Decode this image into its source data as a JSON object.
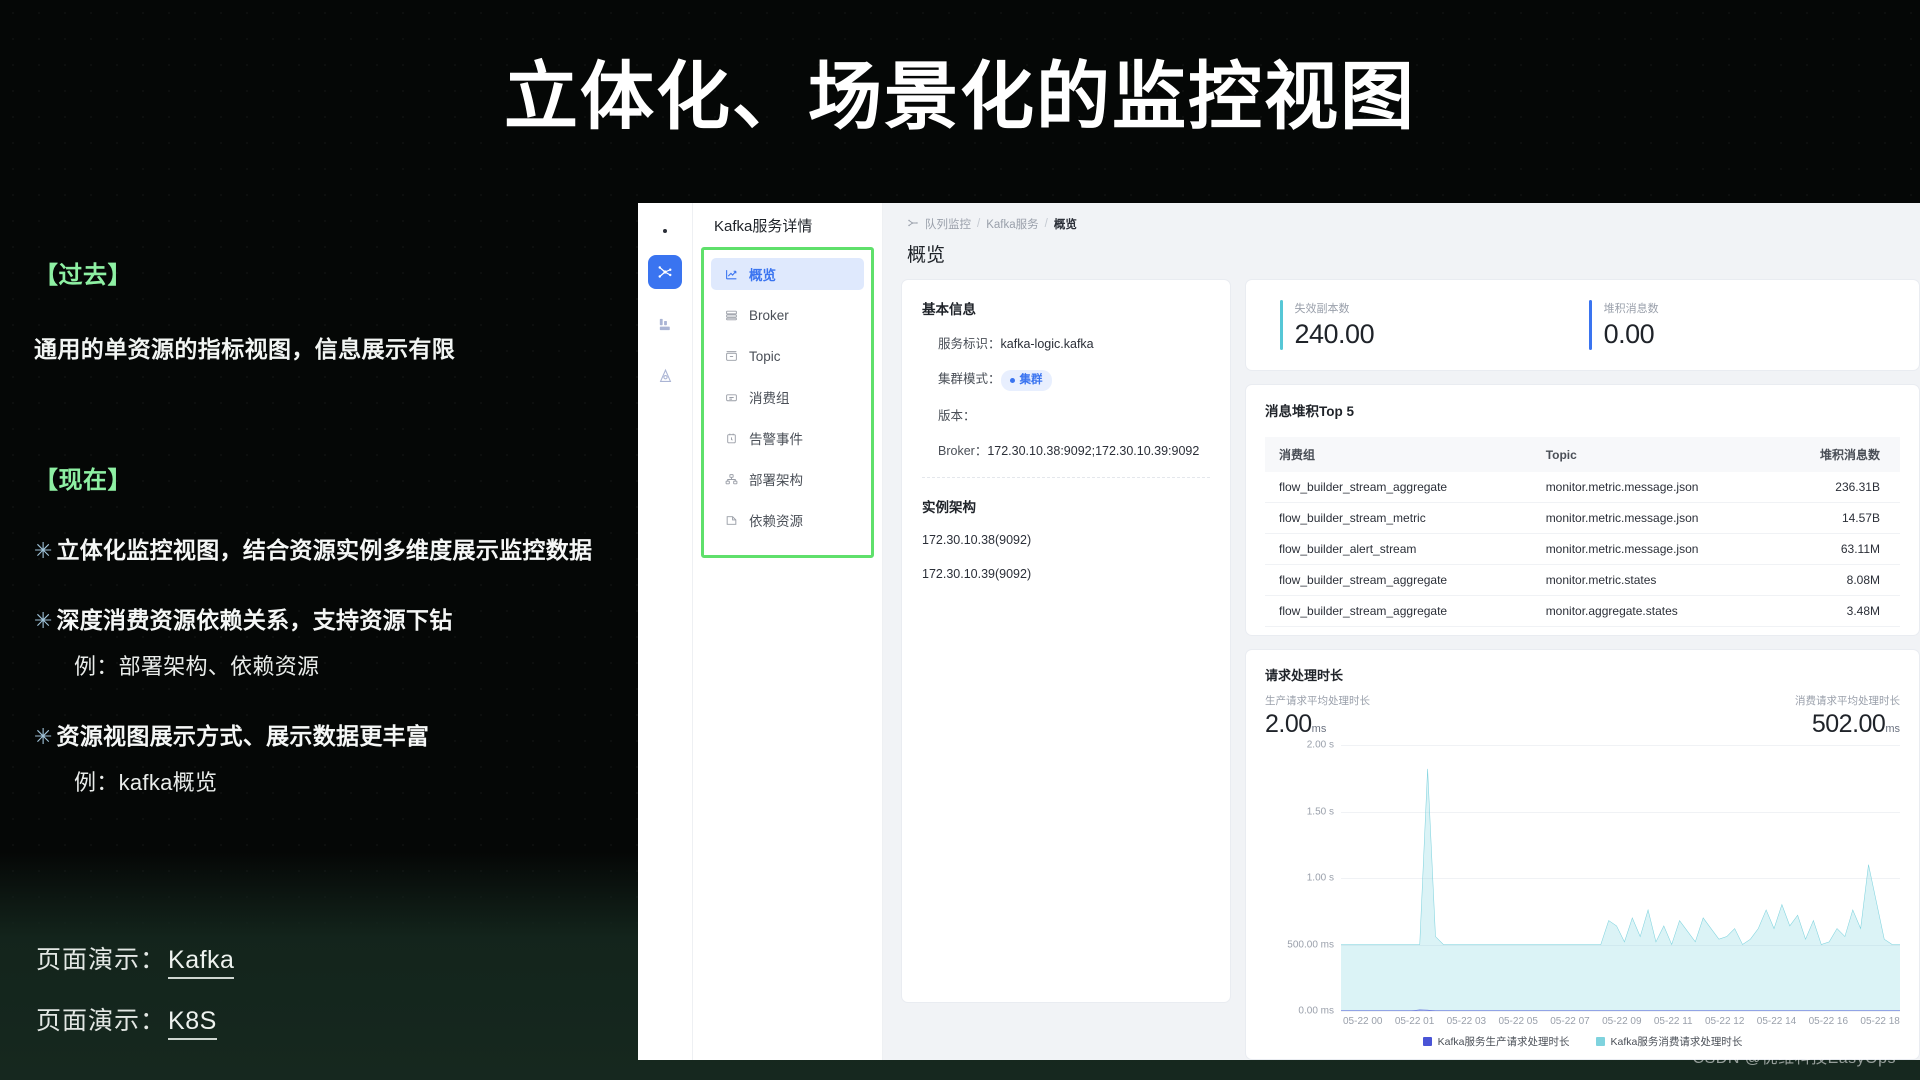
{
  "slide": {
    "title": "立体化、场景化的监控视图",
    "past": {
      "label": "【过去】",
      "body": "通用的单资源的指标视图，信息展示有限"
    },
    "now": {
      "label": "【现在】"
    },
    "bullets": [
      {
        "marker": "✳",
        "text": "立体化监控视图，结合资源实例多维度展示监控数据",
        "sub": ""
      },
      {
        "marker": "✳",
        "text": "深度消费资源依赖关系，支持资源下钻",
        "sub": "例：部署架构、依赖资源"
      },
      {
        "marker": "✳",
        "text": "资源视图展示方式、展示数据更丰富",
        "sub": "例：kafka概览"
      }
    ],
    "demos": [
      {
        "label": "页面演示：",
        "link": "Kafka"
      },
      {
        "label": "页面演示：",
        "link": "K8S"
      }
    ],
    "watermark": "CSDN @优维科技EasyOps",
    "accent_green": "#8ef0a3",
    "highlight_green": "#5fe06b"
  },
  "app": {
    "rail": {
      "icons": [
        "kafka-topology-icon",
        "broker-rack-icon",
        "alarm-bell-icon"
      ]
    },
    "nav": {
      "title": "Kafka服务详情",
      "items": [
        {
          "label": "概览",
          "icon": "chart-line-icon",
          "active": true
        },
        {
          "label": "Broker",
          "icon": "server-icon",
          "active": false
        },
        {
          "label": "Topic",
          "icon": "topic-box-icon",
          "active": false
        },
        {
          "label": "消费组",
          "icon": "consumer-group-icon",
          "active": false
        },
        {
          "label": "告警事件",
          "icon": "alert-clock-icon",
          "active": false
        },
        {
          "label": "部署架构",
          "icon": "deployment-icon",
          "active": false
        },
        {
          "label": "依赖资源",
          "icon": "dependency-icon",
          "active": false
        }
      ]
    },
    "breadcrumb": {
      "icon": "topology-icon",
      "items": [
        "队列监控",
        "Kafka服务",
        "概览"
      ],
      "separator": "/"
    },
    "page_title": "概览",
    "info_card": {
      "heading": "基本信息",
      "rows": [
        {
          "key": "服务标识：",
          "value": "kafka-logic.kafka"
        },
        {
          "key": "集群模式：",
          "value": "集群",
          "type": "pill"
        },
        {
          "key": "版本：",
          "value": ""
        },
        {
          "key": "Broker：",
          "value": "172.30.10.38:9092;172.30.10.39:9092"
        }
      ],
      "arch_heading": "实例架构",
      "instances": [
        "172.30.10.38(9092)",
        "172.30.10.39(9092)"
      ]
    },
    "kpis": [
      {
        "label": "失效副本数",
        "value": "240.00",
        "color": "#56c7d6"
      },
      {
        "label": "堆积消息数",
        "value": "0.00",
        "color": "#3a74f0"
      }
    ],
    "top5": {
      "heading": "消息堆积Top 5",
      "columns": [
        "消费组",
        "Topic",
        "堆积消息数"
      ],
      "rows": [
        [
          "flow_builder_stream_aggregate",
          "monitor.metric.message.json",
          "236.31B"
        ],
        [
          "flow_builder_stream_metric",
          "monitor.metric.message.json",
          "14.57B"
        ],
        [
          "flow_builder_alert_stream",
          "monitor.metric.message.json",
          "63.11M"
        ],
        [
          "flow_builder_stream_aggregate",
          "monitor.metric.states",
          "8.08M"
        ],
        [
          "flow_builder_stream_aggregate",
          "monitor.aggregate.states",
          "3.48M"
        ]
      ]
    },
    "duration": {
      "heading": "请求处理时长",
      "produce": {
        "label": "生产请求平均处理时长",
        "value": "2.00",
        "unit": "ms"
      },
      "consume": {
        "label": "消费请求平均处理时长",
        "value": "502.00",
        "unit": "ms"
      }
    }
  },
  "chart_data": {
    "type": "line",
    "title": "请求处理时长",
    "xlabel": "",
    "ylabel": "",
    "grid": true,
    "legend_position": "bottom",
    "ylim": [
      0,
      2000
    ],
    "ytick_labels": [
      "2.00 s",
      "1.50 s",
      "1.00 s",
      "500.00 ms",
      "0.00 ms"
    ],
    "ytick_values": [
      2000,
      1500,
      1000,
      500,
      0
    ],
    "xtick_labels": [
      "05-22 00",
      "05-22 01",
      "05-22 03",
      "05-22 05",
      "05-22 07",
      "05-22 09",
      "05-22 11",
      "05-22 12",
      "05-22 14",
      "05-22 16",
      "05-22 18"
    ],
    "series": [
      {
        "name": "Kafka服务生产请求处理时长",
        "color": "#4a54d6",
        "values": [
          2,
          2,
          2,
          2,
          2,
          2,
          2,
          2,
          2,
          2,
          8,
          6,
          2,
          2,
          2,
          2,
          2,
          2,
          2,
          2,
          2,
          2,
          2,
          2,
          2,
          2,
          2,
          2,
          2,
          2,
          2,
          2,
          2,
          2,
          2,
          2,
          2,
          2,
          2,
          2,
          2,
          2,
          2,
          2,
          2,
          2,
          2,
          2,
          2,
          2,
          2,
          2,
          2,
          2,
          2,
          2,
          2,
          2,
          2,
          2,
          2,
          2,
          2,
          2,
          2,
          2,
          2,
          2,
          2,
          2,
          2,
          2
        ]
      },
      {
        "name": "Kafka服务消费请求处理时长",
        "color": "#7fd3de",
        "values": [
          500,
          500,
          500,
          500,
          500,
          500,
          500,
          500,
          500,
          500,
          500,
          1820,
          560,
          500,
          500,
          500,
          500,
          500,
          500,
          500,
          500,
          500,
          500,
          500,
          500,
          500,
          500,
          500,
          500,
          500,
          500,
          500,
          500,
          500,
          680,
          640,
          520,
          700,
          560,
          760,
          520,
          640,
          500,
          680,
          600,
          520,
          700,
          620,
          540,
          560,
          620,
          500,
          540,
          620,
          760,
          620,
          800,
          640,
          720,
          540,
          680,
          500,
          520,
          620,
          560,
          760,
          620,
          1100,
          820,
          540,
          500,
          500
        ]
      }
    ]
  }
}
